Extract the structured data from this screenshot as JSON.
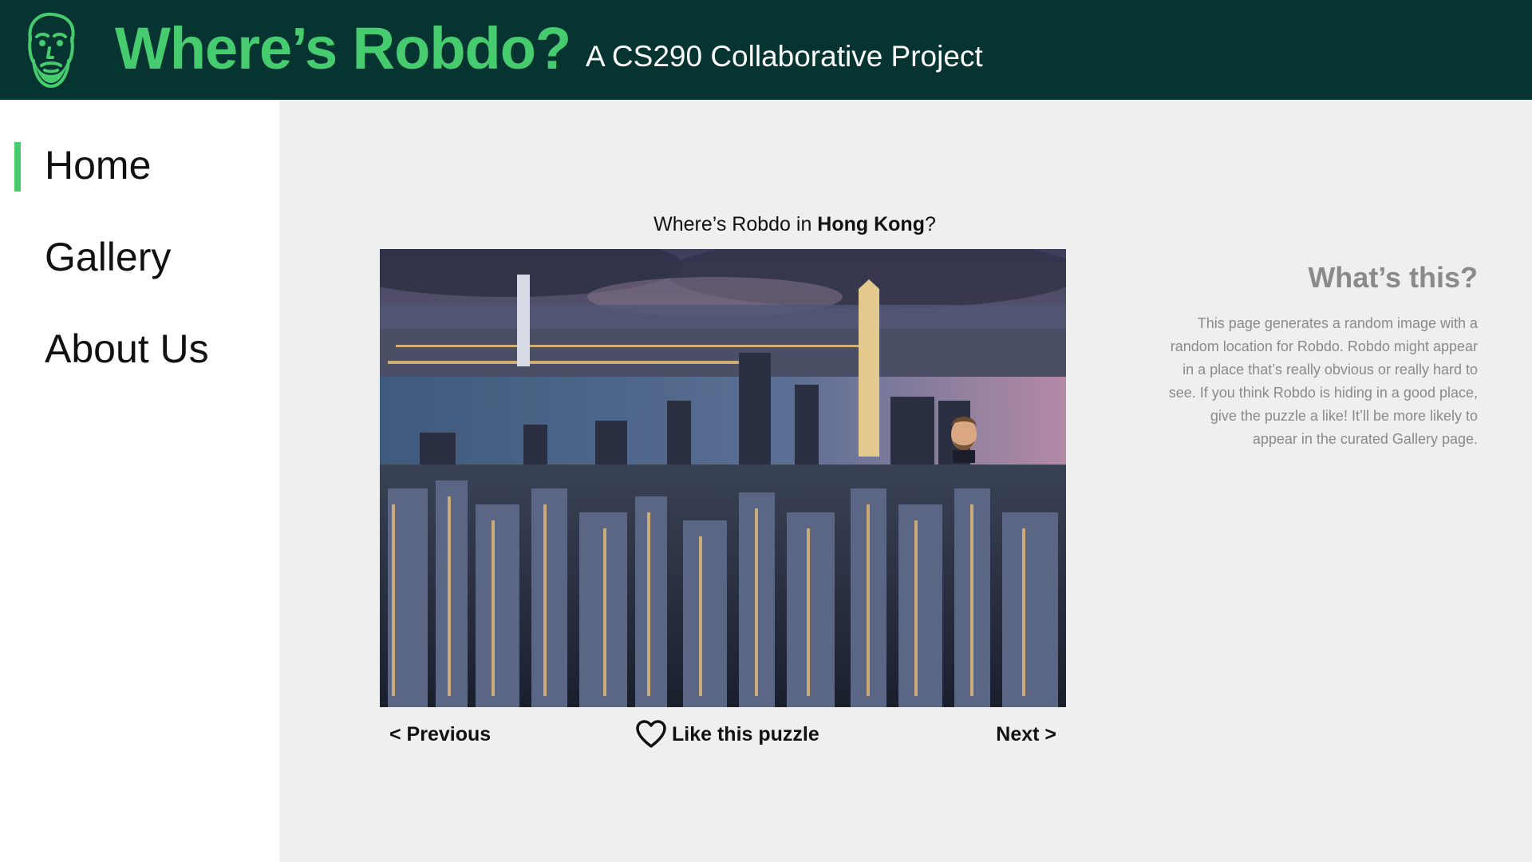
{
  "header": {
    "title": "Where’s Robdo?",
    "subtitle": "A CS290 Collaborative Project",
    "logo_icon": "robdo-face-icon",
    "bg_color": "#063431",
    "accent_color": "#46cc6f"
  },
  "sidebar": {
    "items": [
      {
        "label": "Home",
        "active": true
      },
      {
        "label": "Gallery",
        "active": false
      },
      {
        "label": "About Us",
        "active": false
      }
    ]
  },
  "puzzle": {
    "caption_prefix": "Where’s Robdo in ",
    "location": "Hong Kong",
    "caption_suffix": "?",
    "image_description_icon": "hong-kong-skyline-photo",
    "prev_label": "< Previous",
    "like_label": "Like this puzzle",
    "like_icon": "heart-outline-icon",
    "next_label": "Next >"
  },
  "info": {
    "title": "What’s this?",
    "body": "This page generates a random image with a random location for Robdo. Robdo might appear in a place that’s really obvious or really hard to see. If you think Robdo is hiding in a good place, give the puzzle a like! It’ll be more likely to appear in the curated Gallery page."
  }
}
